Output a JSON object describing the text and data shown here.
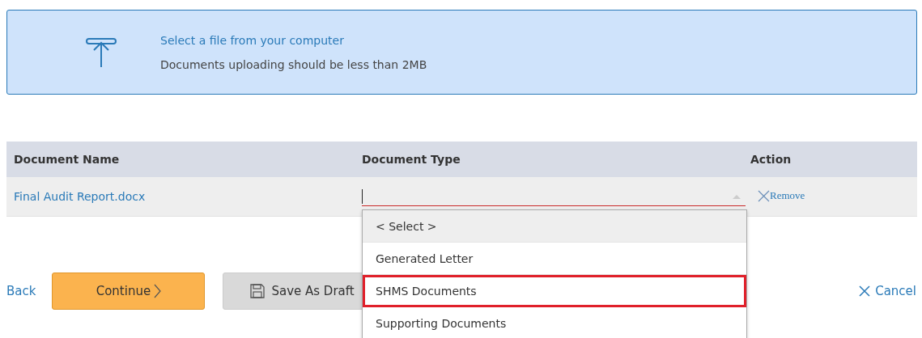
{
  "upload": {
    "title": "Select a file from your computer",
    "note": "Documents uploading should be less than 2MB"
  },
  "table": {
    "columns": [
      "Document Name",
      "Document Type",
      "Action"
    ],
    "rows": [
      {
        "name": "Final Audit Report.docx",
        "type_value": "",
        "action": "Remove"
      }
    ]
  },
  "dropdown": {
    "options": [
      {
        "label": "< Select >",
        "selected": true,
        "outlined": false
      },
      {
        "label": "Generated Letter",
        "selected": false,
        "outlined": false
      },
      {
        "label": "SHMS Documents",
        "selected": false,
        "outlined": true
      },
      {
        "label": "Supporting Documents",
        "selected": false,
        "outlined": false
      }
    ]
  },
  "buttons": {
    "back": "Back",
    "continue": "Continue",
    "draft": "Save As Draft",
    "cancel": "Cancel"
  }
}
